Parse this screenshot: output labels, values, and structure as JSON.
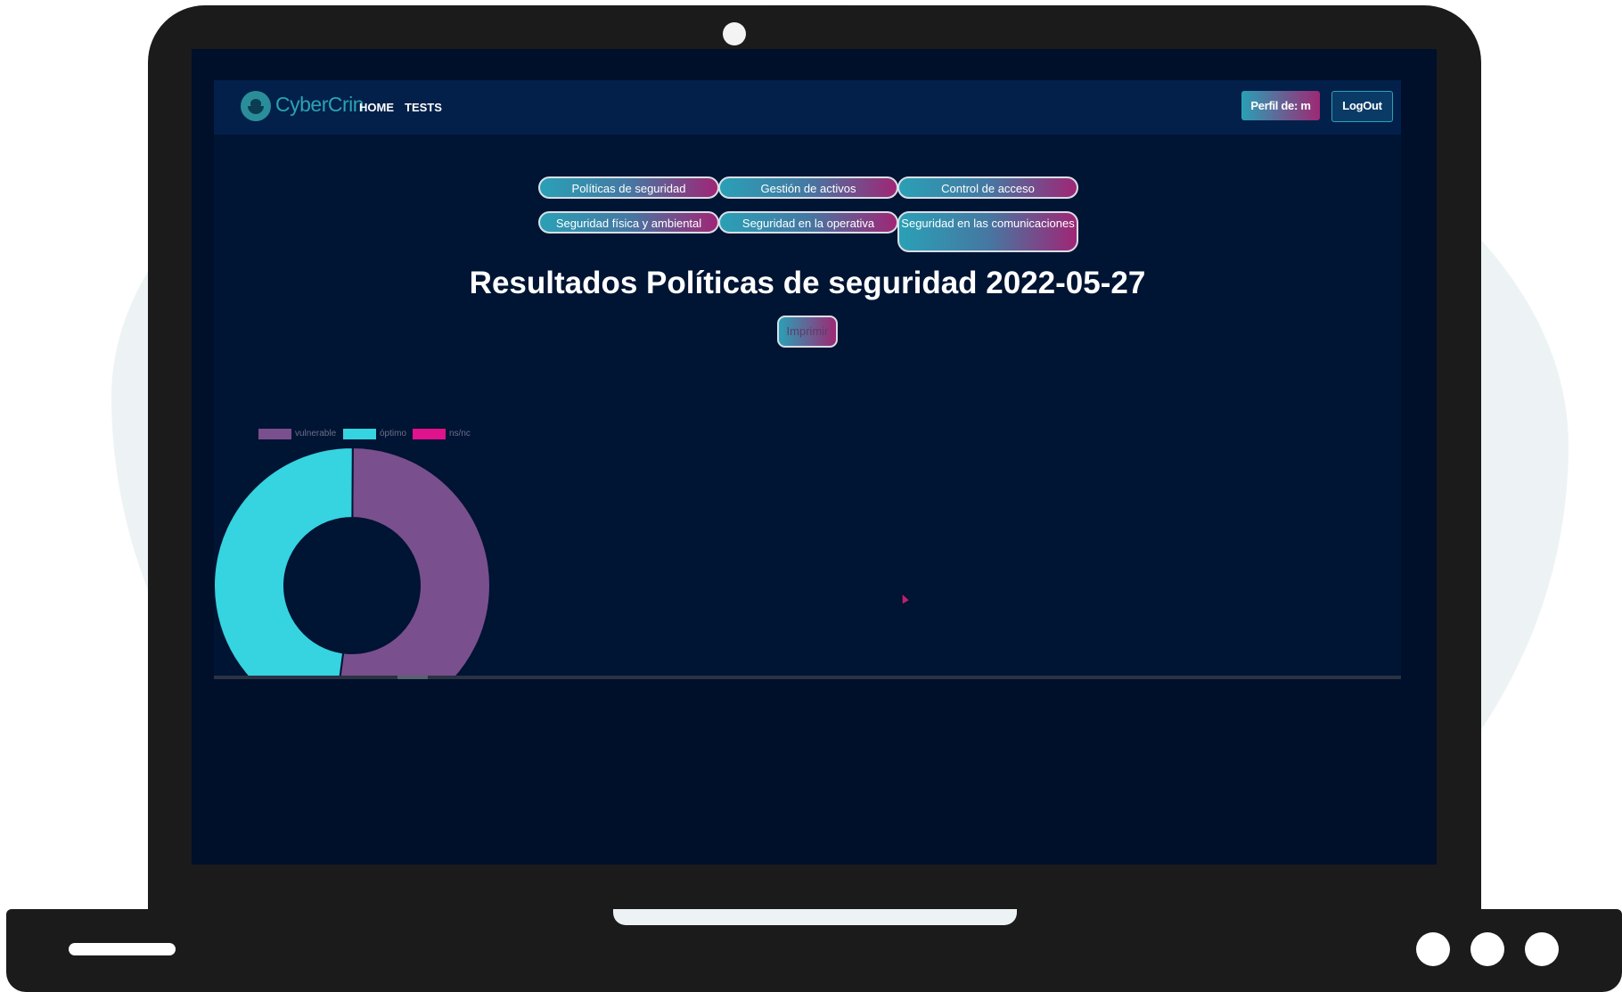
{
  "nav": {
    "logo_text": "CyberCrin",
    "links": [
      "HOME",
      "TESTS"
    ],
    "profile_button": "Perfil de: m",
    "logout_button": "LogOut"
  },
  "categories": [
    "Políticas de seguridad",
    "Gestión de activos",
    "Control de acceso",
    "Seguridad física y ambiental",
    "Seguridad en la operativa",
    "Seguridad en las comunicaciones"
  ],
  "page_title": "Resultados Políticas de seguridad 2022-05-27",
  "print_button": "Imprimir",
  "colors": {
    "vulnerable": "#7a4f8e",
    "optimo": "#36d3e0",
    "nsnc": "#e0128c",
    "background": "#001433",
    "navbar": "#03204a"
  },
  "chart_data": {
    "type": "pie",
    "categories": [
      "vulnerable",
      "óptimo",
      "ns/nc"
    ],
    "values": [
      52,
      48,
      0
    ],
    "legend": "top-left"
  }
}
